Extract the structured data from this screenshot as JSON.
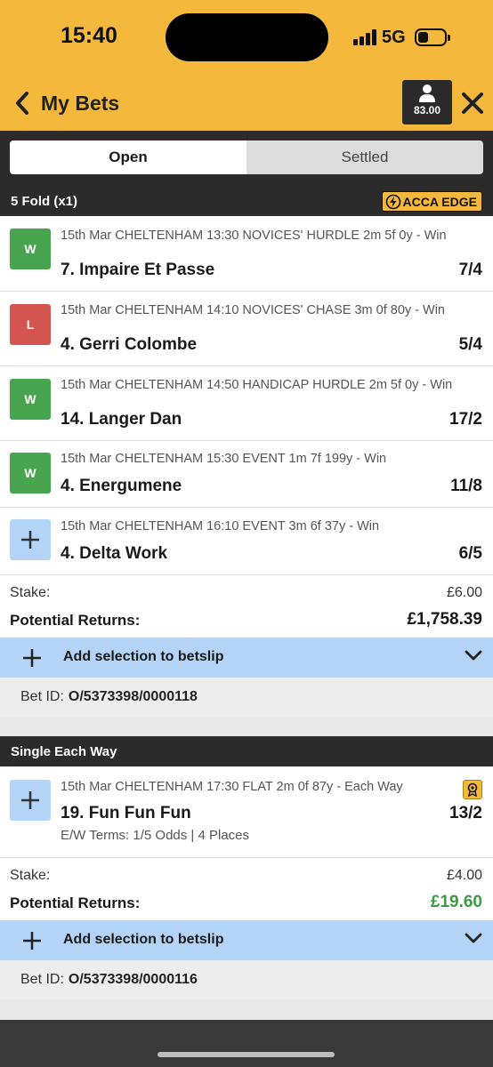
{
  "status_bar": {
    "time": "15:40",
    "network": "5G"
  },
  "header": {
    "title": "My Bets",
    "balance": "83.00"
  },
  "tabs": [
    {
      "label": "Open",
      "active": true
    },
    {
      "label": "Settled",
      "active": false
    }
  ],
  "bet1": {
    "type": "5 Fold (x1)",
    "badge": "ACCA EDGE",
    "legs": [
      {
        "status": "W",
        "desc": "15th Mar CHELTENHAM 13:30 NOVICES' HURDLE 2m 5f 0y - Win",
        "selection": "7. Impaire Et Passe",
        "odds": "7/4"
      },
      {
        "status": "L",
        "desc": "15th Mar CHELTENHAM 14:10 NOVICES' CHASE 3m 0f 80y - Win",
        "selection": "4. Gerri Colombe",
        "odds": "5/4"
      },
      {
        "status": "W",
        "desc": "15th Mar CHELTENHAM 14:50 HANDICAP HURDLE 2m 5f 0y - Win",
        "selection": "14. Langer Dan",
        "odds": "17/2"
      },
      {
        "status": "W",
        "desc": "15th Mar CHELTENHAM 15:30 EVENT 1m 7f 199y - Win",
        "selection": "4. Energumene",
        "odds": "11/8"
      },
      {
        "status": "",
        "desc": "15th Mar CHELTENHAM 16:10 EVENT 3m 6f 37y - Win",
        "selection": "4. Delta Work",
        "odds": "6/5"
      }
    ],
    "stake_label": "Stake:",
    "stake": "£6.00",
    "returns_label": "Potential Returns:",
    "returns": "£1,758.39",
    "add_label": "Add selection to betslip",
    "bet_id_label": "Bet ID:",
    "bet_id": "O/5373398/0000118"
  },
  "bet2": {
    "type": "Single Each Way",
    "leg": {
      "desc": "15th Mar CHELTENHAM 17:30 FLAT 2m 0f 87y - Each Way",
      "selection": "19. Fun Fun Fun",
      "odds": "13/2",
      "ew_terms": "E/W Terms: 1/5 Odds | 4 Places"
    },
    "stake_label": "Stake:",
    "stake": "£4.00",
    "returns_label": "Potential Returns:",
    "returns": "£19.60",
    "add_label": "Add selection to betslip",
    "bet_id_label": "Bet ID:",
    "bet_id": "O/5373398/0000116"
  },
  "colors": {
    "brand_yellow": "#f4b93c",
    "win_green": "#48a44e",
    "lose_red": "#d45450",
    "pending_blue": "#b3d4f6",
    "dark_bar": "#2b2b2b"
  },
  "icons": [
    "signal-icon",
    "battery-icon",
    "chevron-left-icon",
    "user-icon",
    "close-icon",
    "lightning-icon",
    "plus-icon",
    "chevron-down-icon",
    "each-way-icon"
  ]
}
